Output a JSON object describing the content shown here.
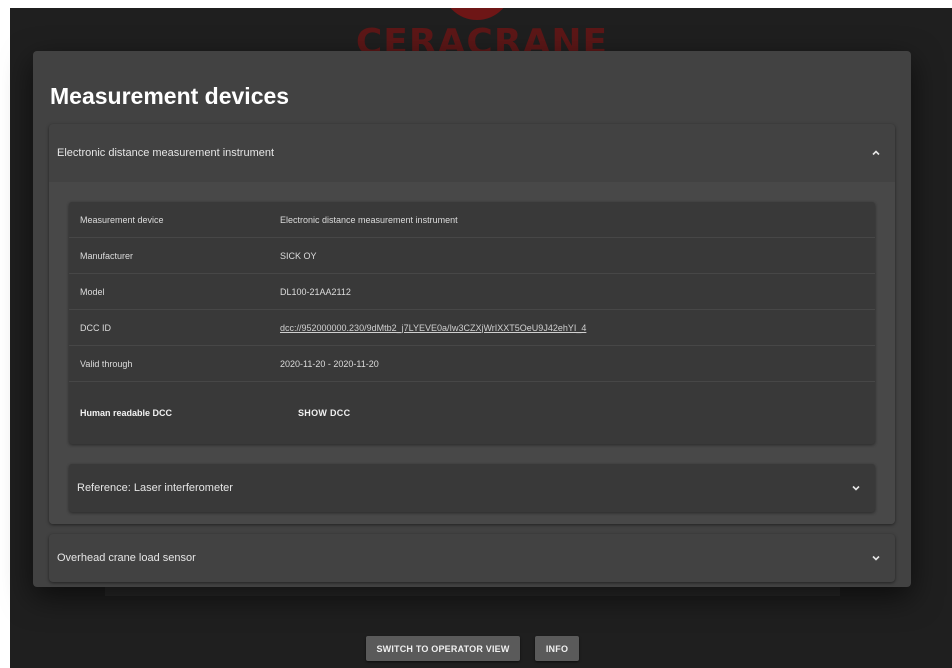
{
  "brand": {
    "logo_text": "CERACRANE"
  },
  "modal": {
    "title": "Measurement devices",
    "accordions": [
      {
        "title": "Electronic distance measurement instrument",
        "expanded": true,
        "details": [
          {
            "label": "Measurement device",
            "value": "Electronic distance measurement instrument"
          },
          {
            "label": "Manufacturer",
            "value": "SICK OY"
          },
          {
            "label": "Model",
            "value": "DL100-21AA2112"
          },
          {
            "label": "DCC ID",
            "value": "dcc://952000000.230/9dMtb2_j7LYEVE0a/Iw3CZXjWrIXXT5OeU9J42ehYI_4"
          },
          {
            "label": "Valid through",
            "value": "2020-11-20 - 2020-11-20"
          }
        ],
        "dcc_label": "Human readable DCC",
        "dcc_button": "SHOW DCC",
        "sub_accordion": {
          "title": "Reference: Laser interferometer",
          "expanded": false
        }
      },
      {
        "title": "Overhead crane load sensor",
        "expanded": false
      }
    ]
  },
  "footer": {
    "switch_button": "SWITCH TO OPERATOR VIEW",
    "info_button": "INFO"
  },
  "icons": {
    "chevron_up": "chevron-up-icon",
    "chevron_down": "chevron-down-icon"
  },
  "colors": {
    "background": "#1f1f1f",
    "modal": "#424242",
    "logo": "#6e1616"
  }
}
